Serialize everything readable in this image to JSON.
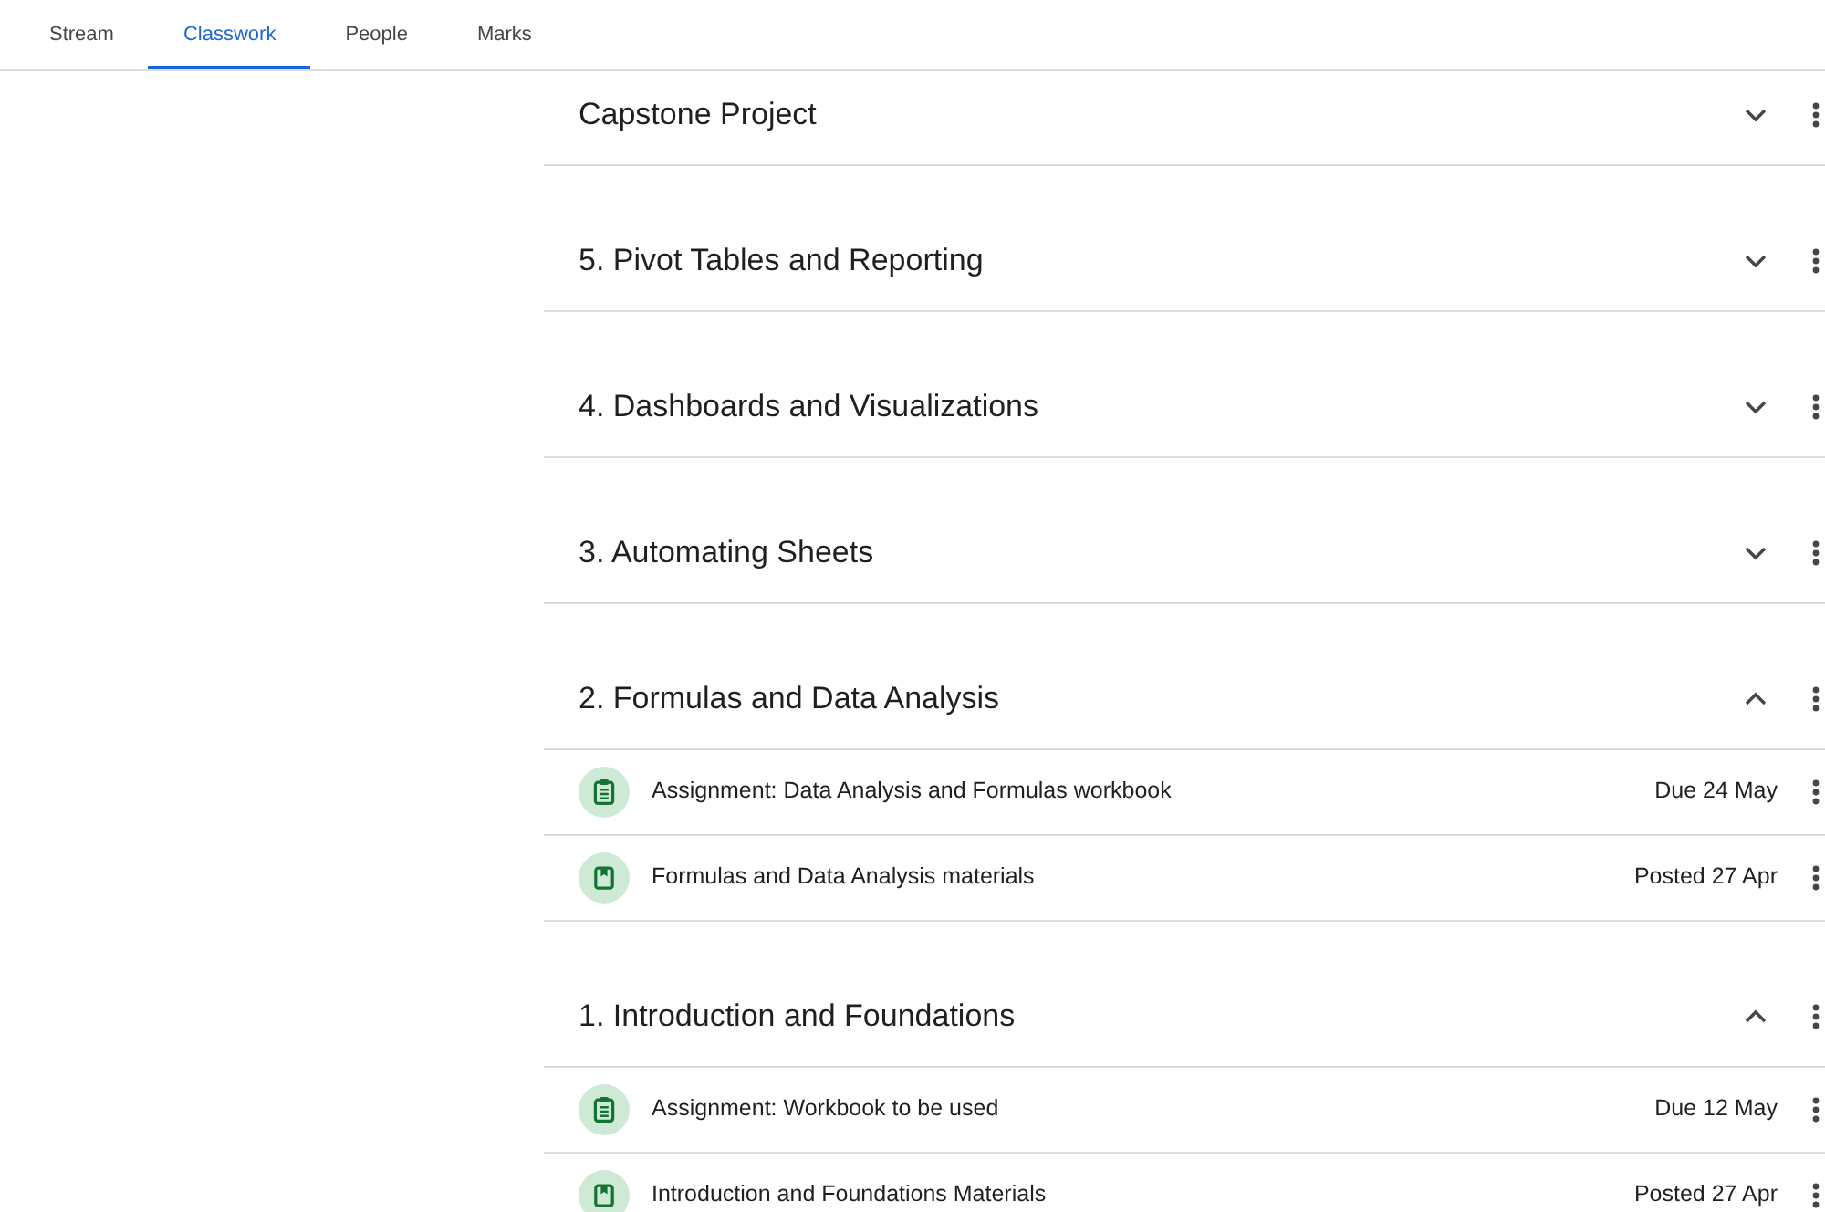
{
  "tabs": [
    {
      "label": "Stream",
      "selected": false
    },
    {
      "label": "Classwork",
      "selected": true
    },
    {
      "label": "People",
      "selected": false
    },
    {
      "label": "Marks",
      "selected": false
    }
  ],
  "topics": [
    {
      "title": "Capstone Project",
      "expanded": false
    },
    {
      "title": "5. Pivot Tables and Reporting",
      "expanded": false
    },
    {
      "title": "4. Dashboards and Visualizations",
      "expanded": false
    },
    {
      "title": "3. Automating Sheets",
      "expanded": false
    },
    {
      "title": "2. Formulas and Data Analysis",
      "expanded": true,
      "items": [
        {
          "kind": "assignment",
          "title": "Assignment: Data Analysis and Formulas workbook",
          "date": "Due 24 May"
        },
        {
          "kind": "material",
          "title": "Formulas and Data Analysis materials",
          "date": "Posted 27 Apr"
        }
      ]
    },
    {
      "title": "1. Introduction and Foundations",
      "expanded": true,
      "items": [
        {
          "kind": "assignment",
          "title": "Assignment: Workbook to be used",
          "date": "Due 12 May"
        },
        {
          "kind": "material",
          "title": "Introduction and Foundations Materials",
          "date": "Posted 27 Apr"
        }
      ]
    }
  ]
}
